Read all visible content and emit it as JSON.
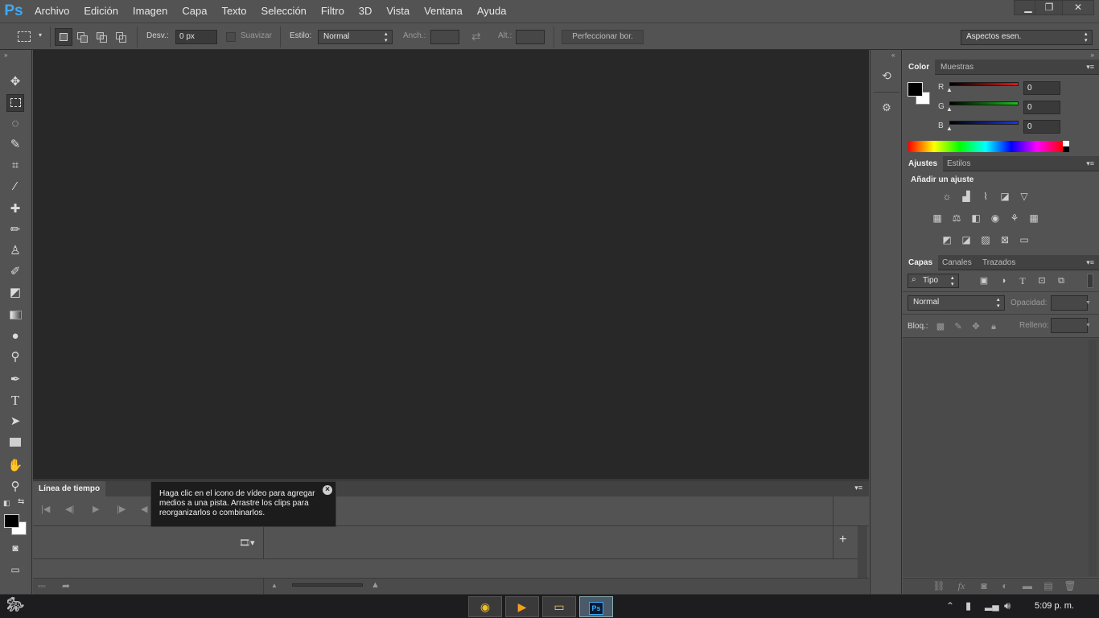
{
  "app": {
    "logo": "Ps"
  },
  "menu": [
    "Archivo",
    "Edición",
    "Imagen",
    "Capa",
    "Texto",
    "Selección",
    "Filtro",
    "3D",
    "Vista",
    "Ventana",
    "Ayuda"
  ],
  "window_controls": {
    "minimize": "▁",
    "restore": "❐",
    "close": "✕"
  },
  "options": {
    "feather_label": "Desv.:",
    "feather_value": "0 px",
    "antialias_label": "Suavizar",
    "style_label": "Estilo:",
    "style_value": "Normal",
    "width_label": "Anch.:",
    "height_label": "Alt.:",
    "refine_button": "Perfeccionar bor.",
    "workspace": "Aspectos esen."
  },
  "timeline": {
    "tab": "Línea de tiempo",
    "tooltip": "Haga clic en el icono de vídeo para agregar medios a una pista. Arrastre los clips para reorganizarlos o combinarlos.",
    "add": "+"
  },
  "color_panel": {
    "tabs": [
      "Color",
      "Muestras"
    ],
    "channels": [
      {
        "label": "R",
        "value": "0",
        "color": "#e01818"
      },
      {
        "label": "G",
        "value": "0",
        "color": "#18c018"
      },
      {
        "label": "B",
        "value": "0",
        "color": "#1838e8"
      }
    ]
  },
  "adjust_panel": {
    "tabs": [
      "Ajustes",
      "Estilos"
    ],
    "heading": "Añadir un ajuste"
  },
  "layers_panel": {
    "tabs": [
      "Capas",
      "Canales",
      "Trazados"
    ],
    "filter_value": "Tipo",
    "blend_value": "Normal",
    "opacity_label": "Opacidad:",
    "lock_label": "Bloq.:",
    "fill_label": "Relleno:"
  },
  "taskbar": {
    "clock": "5:09 p. m."
  },
  "colors": {
    "accent": "#3fa9f5",
    "canvas": "#282828",
    "chrome": "#535353"
  }
}
